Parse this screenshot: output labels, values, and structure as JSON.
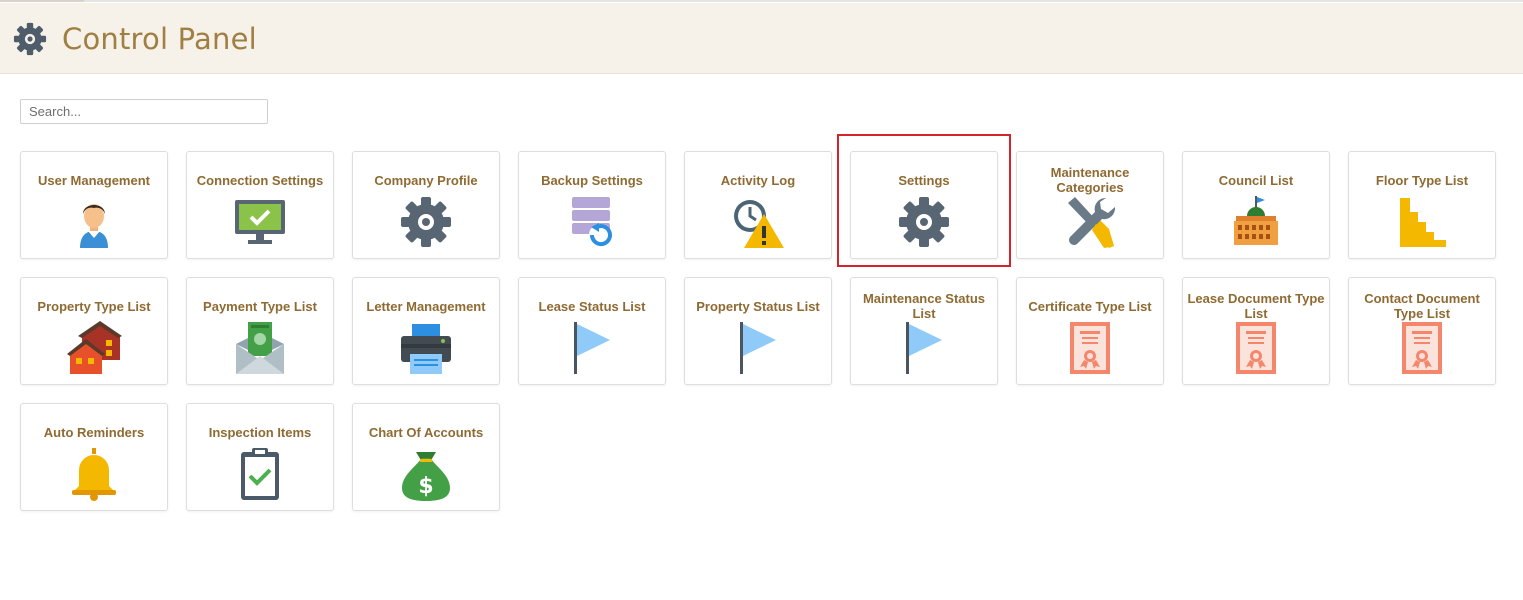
{
  "header": {
    "title": "Control Panel",
    "icon": "gear-icon"
  },
  "search": {
    "placeholder": "Search..."
  },
  "tiles": [
    {
      "label": "User Management",
      "icon": "user-icon"
    },
    {
      "label": "Connection Settings",
      "icon": "monitor-check-icon"
    },
    {
      "label": "Company Profile",
      "icon": "gear-icon"
    },
    {
      "label": "Backup Settings",
      "icon": "database-restore-icon"
    },
    {
      "label": "Activity Log",
      "icon": "clock-warning-icon"
    },
    {
      "label": "Settings",
      "icon": "gear-icon"
    },
    {
      "label": "Maintenance Categories",
      "icon": "tools-icon"
    },
    {
      "label": "Council List",
      "icon": "government-building-icon"
    },
    {
      "label": "Floor Type List",
      "icon": "stairs-icon"
    },
    {
      "label": "Property Type List",
      "icon": "houses-icon"
    },
    {
      "label": "Payment Type List",
      "icon": "money-envelope-icon"
    },
    {
      "label": "Letter Management",
      "icon": "printer-icon"
    },
    {
      "label": "Lease Status List",
      "icon": "flag-icon"
    },
    {
      "label": "Property Status List",
      "icon": "flag-icon"
    },
    {
      "label": "Maintenance Status List",
      "icon": "flag-icon"
    },
    {
      "label": "Certificate Type List",
      "icon": "certificate-icon"
    },
    {
      "label": "Lease Document Type List",
      "icon": "certificate-icon"
    },
    {
      "label": "Contact Document Type List",
      "icon": "certificate-icon"
    },
    {
      "label": "Auto Reminders",
      "icon": "bell-icon"
    },
    {
      "label": "Inspection Items",
      "icon": "clipboard-check-icon"
    },
    {
      "label": "Chart Of Accounts",
      "icon": "money-bag-icon"
    }
  ],
  "highlighted_tile": "Settings",
  "colors": {
    "label": "#8f6a32",
    "header_bg": "#f6f2ea",
    "title": "#a07f43",
    "highlight": "#d4232a"
  }
}
